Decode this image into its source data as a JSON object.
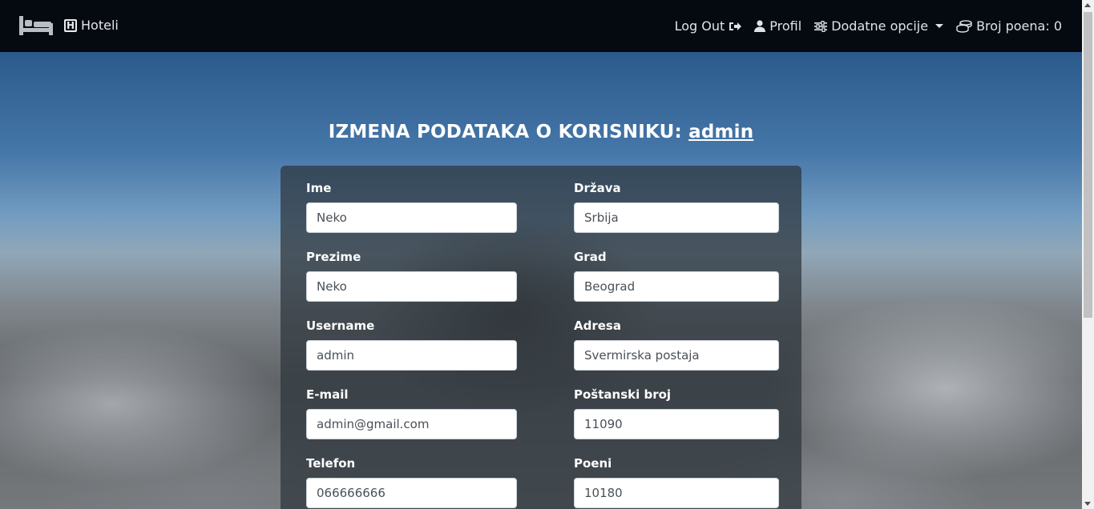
{
  "navbar": {
    "brand_icon": "bed-icon",
    "brand_label": "Hoteli",
    "logout_label": "Log Out",
    "profile_label": "Profil",
    "options_label": "Dodatne opcije",
    "points_label": "Broj poena: 0"
  },
  "heading": {
    "prefix": "IZMENA PODATAKA O KORISNIKU:",
    "username": "admin"
  },
  "form": {
    "ime": {
      "label": "Ime",
      "value": "Neko"
    },
    "drzava": {
      "label": "Država",
      "value": "Srbija"
    },
    "prezime": {
      "label": "Prezime",
      "value": "Neko"
    },
    "grad": {
      "label": "Grad",
      "value": "Beograd"
    },
    "username": {
      "label": "Username",
      "value": "admin"
    },
    "adresa": {
      "label": "Adresa",
      "value": "Svermirska postaja"
    },
    "email": {
      "label": "E-mail",
      "value": "admin@gmail.com"
    },
    "postanski_broj": {
      "label": "Poštanski broj",
      "value": "11090"
    },
    "telefon": {
      "label": "Telefon",
      "value": "066666666"
    },
    "poeni": {
      "label": "Poeni",
      "value": "10180"
    }
  },
  "colors": {
    "navbar_bg": "#050a10",
    "panel_bg": "rgba(45,52,60,0.72)",
    "text_light": "#ffffff"
  }
}
